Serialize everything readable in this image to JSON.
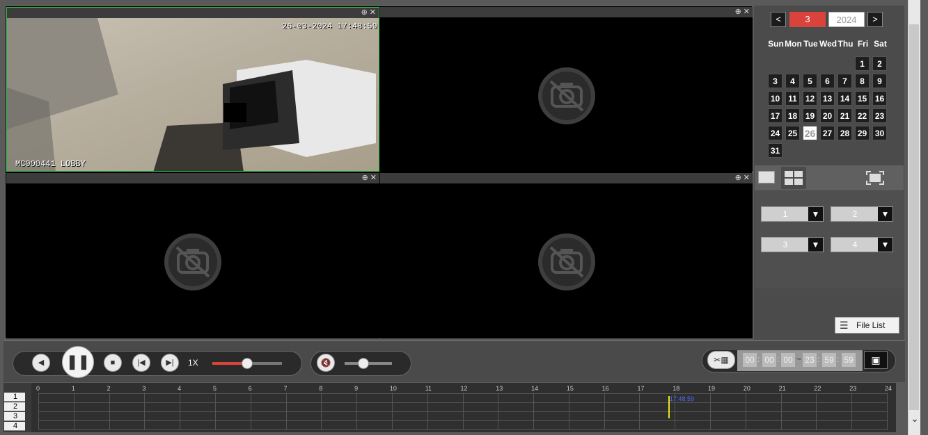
{
  "video": {
    "cam1_timestamp": "26-03-2024 17:48:59",
    "cam1_label": "MC000441 LOBBY",
    "pane_zoom_icon": "zoom-in-icon",
    "pane_close_icon": "close-icon",
    "no_video_icon": "no-camera-icon"
  },
  "calendar": {
    "prev": "<",
    "next": ">",
    "month": "3",
    "year": "2024",
    "weekdays": [
      "Sun",
      "Mon",
      "Tue",
      "Wed",
      "Thu",
      "Fri",
      "Sat"
    ],
    "days": [
      "1",
      "2",
      "3",
      "4",
      "5",
      "6",
      "7",
      "8",
      "9",
      "10",
      "11",
      "12",
      "13",
      "14",
      "15",
      "16",
      "17",
      "18",
      "19",
      "20",
      "21",
      "22",
      "23",
      "24",
      "25",
      "26",
      "27",
      "28",
      "29",
      "30",
      "31"
    ],
    "selected_day": "26",
    "accent": "#d9433b"
  },
  "channels": {
    "ch1": "1",
    "ch2": "2",
    "ch3": "3",
    "ch4": "4"
  },
  "file_list_label": "File List",
  "controls": {
    "speed": "1X",
    "speed_level": 0.5,
    "volume_level": 0.4,
    "clip_start": [
      "00",
      "00",
      "00"
    ],
    "sep1": ":",
    "tilde": "~",
    "clip_end": [
      "23",
      "59",
      "59"
    ]
  },
  "timeline": {
    "channels": [
      "1",
      "2",
      "3",
      "4"
    ],
    "hours": [
      "0",
      "1",
      "2",
      "3",
      "4",
      "5",
      "6",
      "7",
      "8",
      "9",
      "10",
      "11",
      "12",
      "13",
      "14",
      "15",
      "16",
      "17",
      "18",
      "19",
      "20",
      "21",
      "22",
      "23",
      "24"
    ],
    "cursor_time": "17:48:59"
  }
}
